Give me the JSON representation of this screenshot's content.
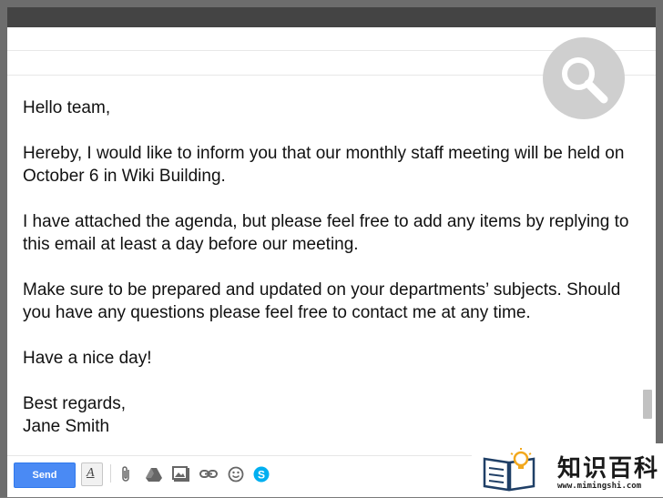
{
  "email": {
    "greeting": "Hello team,",
    "paragraph1": "Hereby, I would like to inform you that our monthly staff meeting will be held on October 6 in Wiki Building.",
    "paragraph2": "I have attached the agenda, but please feel free to add any items by replying to this email at least a day before our meeting.",
    "paragraph3": "Make sure to be prepared and updated on your departments’ subjects. Should you have any questions please feel free to contact me at any time.",
    "closing_wish": "Have a nice day!",
    "sign_off": "Best regards,",
    "signature": "Jane Smith"
  },
  "toolbar": {
    "send_label": "Send",
    "icons": [
      "formatting-icon",
      "attach-icon",
      "drive-icon",
      "photo-icon",
      "link-icon",
      "emoji-icon",
      "skype-icon"
    ]
  },
  "overlay": {
    "search_badge": "magnifier-icon"
  },
  "watermark": {
    "title": "知识百科",
    "url": "www.mimingshi.com"
  },
  "colors": {
    "send_button": "#4a8af4",
    "badge": "#cfcfcf",
    "text": "#111111"
  }
}
